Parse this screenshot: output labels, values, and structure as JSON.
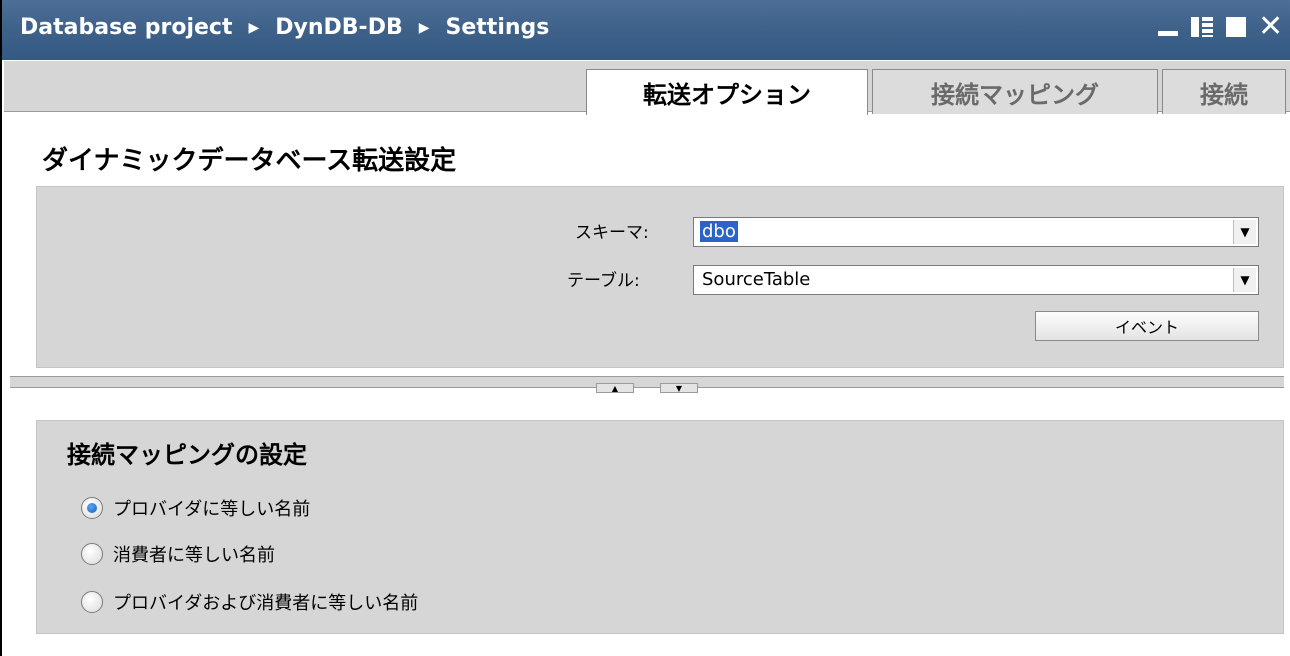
{
  "titlebar": {
    "breadcrumb": [
      "Database project",
      "DynDB-DB",
      "Settings"
    ],
    "separator": "▶"
  },
  "tabs": [
    {
      "label": "転送オプション",
      "active": true
    },
    {
      "label": "接続マッピング",
      "active": false
    },
    {
      "label": "接続",
      "active": false
    }
  ],
  "section_title": "ダイナミックデータベース転送設定",
  "transfer": {
    "schema_label": "スキーマ:",
    "schema_value": "dbo",
    "table_label": "テーブル:",
    "table_value": "SourceTable",
    "event_button": "イベント"
  },
  "mapping": {
    "title": "接続マッピングの設定",
    "options": [
      {
        "label": "プロバイダに等しい名前",
        "checked": true
      },
      {
        "label": "消費者に等しい名前",
        "checked": false
      },
      {
        "label": "プロバイダおよび消費者に等しい名前",
        "checked": false
      }
    ]
  },
  "colors": {
    "titlebar": "#3e6189",
    "selection": "#2b63c6",
    "panel": "#d6d6d6"
  }
}
